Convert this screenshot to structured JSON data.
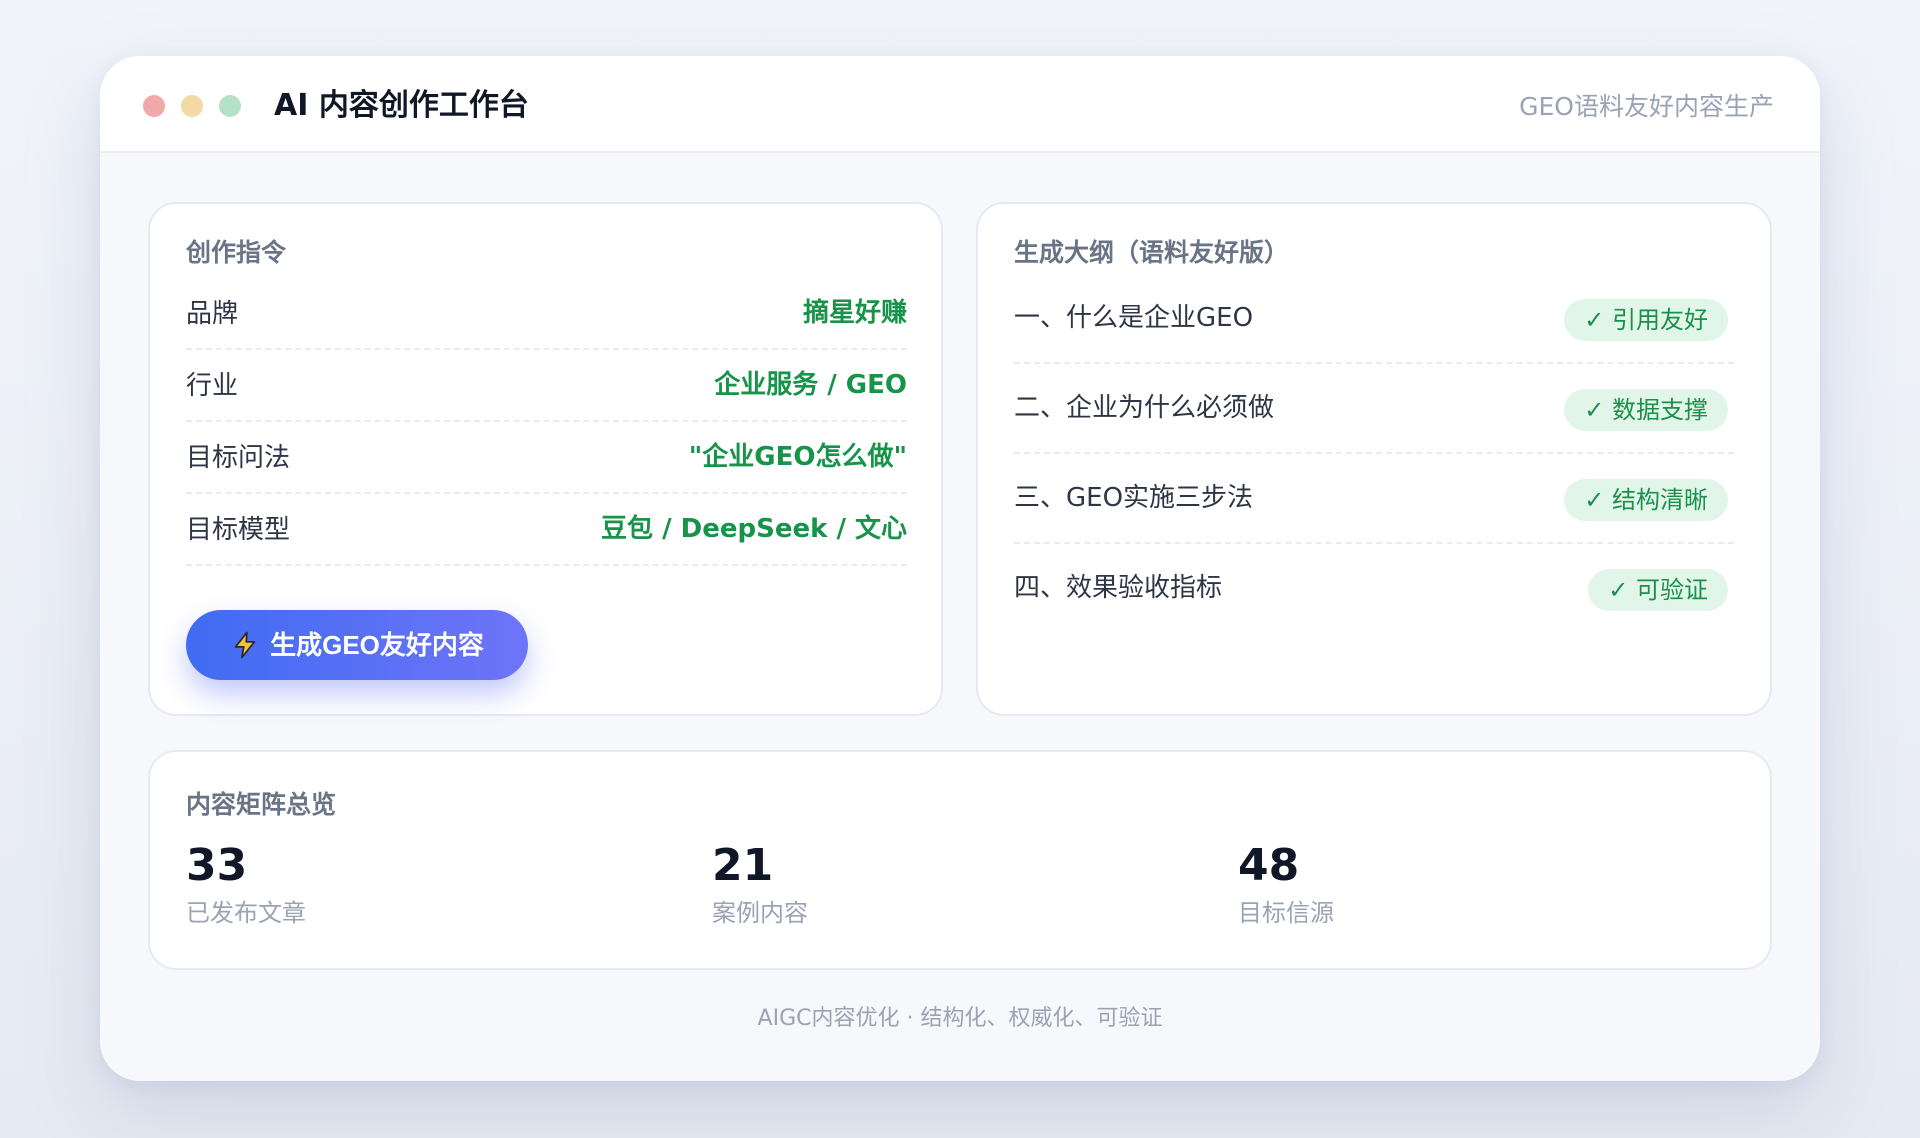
{
  "window": {
    "title": "AI 内容创作工作台",
    "subtitle": "GEO语料友好内容生产"
  },
  "brief": {
    "heading": "创作指令",
    "fields": [
      {
        "label": "品牌",
        "value": "摘星好赚"
      },
      {
        "label": "行业",
        "value": "企业服务 / GEO"
      },
      {
        "label": "目标问法",
        "value": "\"企业GEO怎么做\""
      },
      {
        "label": "目标模型",
        "value": "豆包 / DeepSeek / 文心"
      }
    ],
    "generate_button": {
      "label": "生成GEO友好内容",
      "icon": "lightning-icon"
    }
  },
  "outline": {
    "heading": "生成大纲（语料友好版）",
    "items": [
      {
        "text": "一、什么是企业GEO",
        "badge": "✓ 引用友好"
      },
      {
        "text": "二、企业为什么必须做",
        "badge": "✓ 数据支撑"
      },
      {
        "text": "三、GEO实施三步法",
        "badge": "✓ 结构清晰"
      },
      {
        "text": "四、效果验收指标",
        "badge": "✓ 可验证"
      }
    ]
  },
  "matrix": {
    "heading": "内容矩阵总览",
    "stats": [
      {
        "value": "33",
        "label": "已发布文章"
      },
      {
        "value": "21",
        "label": "案例内容"
      },
      {
        "value": "48",
        "label": "目标信源"
      }
    ]
  },
  "footer": "AIGC内容优化 · 结构化、权威化、可验证",
  "colors": {
    "accent_green": "#17934a",
    "badge_bg": "#e2f5e9",
    "button_gradient_start": "#3f6cf2",
    "button_gradient_end": "#6f74f7"
  }
}
